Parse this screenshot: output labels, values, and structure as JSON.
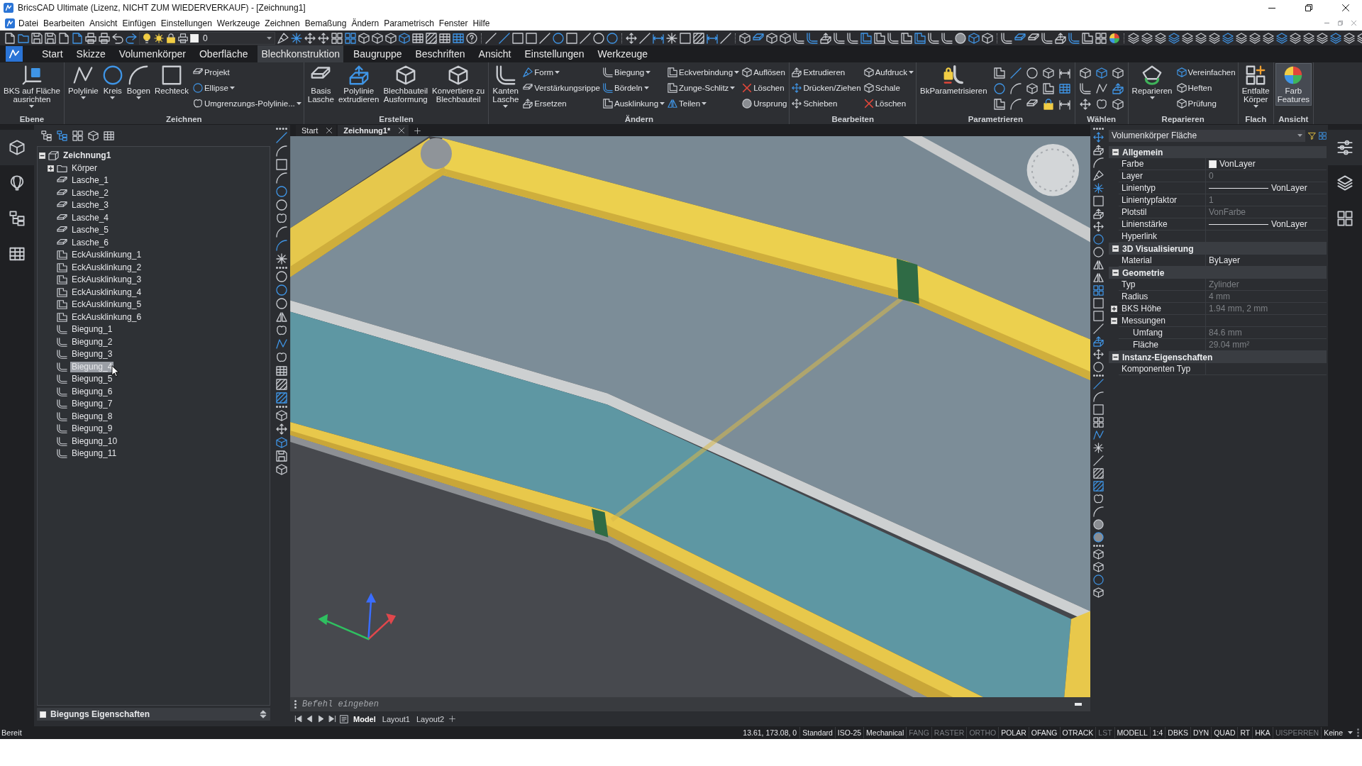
{
  "window": {
    "title": "BricsCAD Ultimate (Lizenz, NICHT ZUM WIEDERVERKAUF) - [Zeichnung1]"
  },
  "menu": [
    "Datei",
    "Bearbeiten",
    "Ansicht",
    "Einfügen",
    "Einstellungen",
    "Werkzeuge",
    "Zeichnen",
    "Bemaßung",
    "Ändern",
    "Parametrisch",
    "Fenster",
    "Hilfe"
  ],
  "quick_access": {
    "layer": "0"
  },
  "ribbon": {
    "tabs": [
      {
        "label": "Start",
        "selected": false
      },
      {
        "label": "Skizze",
        "selected": false
      },
      {
        "label": "Volumenkörper",
        "selected": false
      },
      {
        "label": "Oberfläche",
        "selected": false
      },
      {
        "label": "Blechkonstruktion",
        "selected": true
      },
      {
        "label": "Baugruppe",
        "selected": false
      },
      {
        "label": "Beschriften",
        "selected": false
      },
      {
        "label": "Ansicht",
        "selected": false
      },
      {
        "label": "Einstellungen",
        "selected": false
      },
      {
        "label": "Werkzeuge",
        "selected": false
      }
    ],
    "panels": [
      {
        "title": "Ebene",
        "groups": [
          {
            "kind": "large",
            "buttons": [
              {
                "label": "BKS auf Fläche\nausrichten",
                "dropdown": true
              }
            ]
          }
        ]
      },
      {
        "title": "Zeichnen",
        "groups": [
          {
            "kind": "large",
            "buttons": [
              {
                "label": "Polylinie",
                "dropdown": true
              },
              {
                "label": "Kreis",
                "dropdown": true
              },
              {
                "label": "Bogen",
                "dropdown": true
              },
              {
                "label": "Rechteck",
                "dropdown": false
              }
            ]
          },
          {
            "kind": "small",
            "buttons": [
              {
                "label": "Projekt",
                "dropdown": false
              },
              {
                "label": "Ellipse",
                "dropdown": true
              },
              {
                "label": "Umgrenzungs-Polylinie...",
                "dropdown": true
              }
            ]
          }
        ]
      },
      {
        "title": "Erstellen",
        "groups": [
          {
            "kind": "large",
            "buttons": [
              {
                "label": "Basis\nLasche",
                "dropdown": false
              },
              {
                "label": "Polylinie\nextrudieren",
                "dropdown": false
              },
              {
                "label": "Blechbauteil\nAusformung",
                "dropdown": false
              },
              {
                "label": "Konvertiere zu\nBlechbauteil",
                "dropdown": false
              }
            ]
          }
        ]
      },
      {
        "title": "Ändern",
        "groups": [
          {
            "kind": "large",
            "buttons": [
              {
                "label": "Kanten\nLasche",
                "dropdown": true
              }
            ]
          },
          {
            "kind": "small",
            "buttons": [
              {
                "label": "Form",
                "dropdown": true
              },
              {
                "label": "Verstärkungsrippe",
                "dropdown": false
              },
              {
                "label": "Ersetzen",
                "dropdown": false
              }
            ]
          },
          {
            "kind": "small",
            "buttons": [
              {
                "label": "Biegung",
                "dropdown": true
              },
              {
                "label": "Bördeln",
                "dropdown": true
              },
              {
                "label": "Ausklinkung",
                "dropdown": true
              }
            ]
          },
          {
            "kind": "small",
            "buttons": [
              {
                "label": "Eckverbindung",
                "dropdown": true
              },
              {
                "label": "Zunge-Schlitz",
                "dropdown": true
              },
              {
                "label": "Teilen",
                "dropdown": true
              }
            ]
          },
          {
            "kind": "small",
            "buttons": [
              {
                "label": "Auflösen",
                "dropdown": false
              },
              {
                "label": "Löschen",
                "dropdown": false
              },
              {
                "label": "Ursprung",
                "dropdown": false
              }
            ]
          }
        ]
      },
      {
        "title": "Bearbeiten",
        "groups": [
          {
            "kind": "small",
            "buttons": [
              {
                "label": "Extrudieren",
                "dropdown": false
              },
              {
                "label": "Drücken/Ziehen",
                "dropdown": false
              },
              {
                "label": "Schieben",
                "dropdown": false
              }
            ]
          },
          {
            "kind": "small",
            "buttons": [
              {
                "label": "Aufdruck",
                "dropdown": true
              },
              {
                "label": "Schale",
                "dropdown": false
              },
              {
                "label": "Löschen",
                "dropdown": false
              }
            ]
          }
        ]
      },
      {
        "title": "Parametrieren",
        "groups": [
          {
            "kind": "large",
            "buttons": [
              {
                "label": "BkParametrisieren",
                "dropdown": false
              }
            ]
          },
          {
            "kind": "icons"
          }
        ]
      },
      {
        "title": "Wählen",
        "groups": [
          {
            "kind": "icons"
          }
        ]
      },
      {
        "title": "Reparieren",
        "groups": [
          {
            "kind": "large",
            "buttons": [
              {
                "label": "Reparieren",
                "dropdown": true
              }
            ]
          },
          {
            "kind": "small",
            "buttons": [
              {
                "label": "Vereinfachen",
                "dropdown": false
              },
              {
                "label": "Heften",
                "dropdown": false
              },
              {
                "label": "Prüfung",
                "dropdown": false
              }
            ]
          }
        ]
      },
      {
        "title": "Flach",
        "groups": [
          {
            "kind": "large",
            "buttons": [
              {
                "label": "Entfalte\nKörper",
                "dropdown": true
              }
            ]
          }
        ]
      },
      {
        "title": "Ansicht",
        "groups": [
          {
            "kind": "large",
            "buttons": [
              {
                "label": "Farb\nFeatures",
                "dropdown": false,
                "active": true
              }
            ]
          }
        ]
      }
    ]
  },
  "left_dock": [
    {
      "selected": true
    },
    {
      "selected": false
    },
    {
      "selected": false
    },
    {
      "selected": false
    }
  ],
  "browser": {
    "tree": [
      {
        "label": "Zeichnung1",
        "kind": "drawing",
        "expanded": true,
        "selected": false,
        "children": [
          {
            "label": "Körper",
            "kind": "folder",
            "expanded": false,
            "selected": false
          },
          {
            "label": "Lasche_1",
            "kind": "flange",
            "selected": false
          },
          {
            "label": "Lasche_2",
            "kind": "flange",
            "selected": false
          },
          {
            "label": "Lasche_3",
            "kind": "flange",
            "selected": false
          },
          {
            "label": "Lasche_4",
            "kind": "flange",
            "selected": false
          },
          {
            "label": "Lasche_5",
            "kind": "flange",
            "selected": false
          },
          {
            "label": "Lasche_6",
            "kind": "flange",
            "selected": false
          },
          {
            "label": "EckAusklinkung_1",
            "kind": "corner-relief",
            "selected": false
          },
          {
            "label": "EckAusklinkung_2",
            "kind": "corner-relief",
            "selected": false
          },
          {
            "label": "EckAusklinkung_3",
            "kind": "corner-relief",
            "selected": false
          },
          {
            "label": "EckAusklinkung_4",
            "kind": "corner-relief",
            "selected": false
          },
          {
            "label": "EckAusklinkung_5",
            "kind": "corner-relief",
            "selected": false
          },
          {
            "label": "EckAusklinkung_6",
            "kind": "corner-relief",
            "selected": false
          },
          {
            "label": "Biegung_1",
            "kind": "bend",
            "selected": false
          },
          {
            "label": "Biegung_2",
            "kind": "bend",
            "selected": false
          },
          {
            "label": "Biegung_3",
            "kind": "bend",
            "selected": false
          },
          {
            "label": "Biegung_4",
            "kind": "bend",
            "selected": true
          },
          {
            "label": "Biegung_5",
            "kind": "bend",
            "selected": false
          },
          {
            "label": "Biegung_6",
            "kind": "bend",
            "selected": false
          },
          {
            "label": "Biegung_7",
            "kind": "bend",
            "selected": false
          },
          {
            "label": "Biegung_8",
            "kind": "bend",
            "selected": false
          },
          {
            "label": "Biegung_9",
            "kind": "bend",
            "selected": false
          },
          {
            "label": "Biegung_10",
            "kind": "bend",
            "selected": false
          },
          {
            "label": "Biegung_11",
            "kind": "bend",
            "selected": false
          }
        ]
      }
    ],
    "footer": "Biegungs Eigenschaften"
  },
  "document_tabs": [
    {
      "label": "Start",
      "selected": false
    },
    {
      "label": "Zeichnung1*",
      "selected": true
    }
  ],
  "command_line": {
    "placeholder": "Befehl eingeben"
  },
  "layout_tabs": [
    {
      "label": "Model",
      "selected": true
    },
    {
      "label": "Layout1",
      "selected": false
    },
    {
      "label": "Layout2",
      "selected": false
    }
  ],
  "properties": {
    "selector": "Volumenkörper Fläche",
    "sections": [
      {
        "title": "Allgemein",
        "expanded": true,
        "rows": [
          {
            "label": "Farbe",
            "value": "VonLayer",
            "kind": "color",
            "disabled": false
          },
          {
            "label": "Layer",
            "value": "0",
            "kind": "text",
            "disabled": true
          },
          {
            "label": "Linientyp",
            "value": "VonLayer",
            "kind": "linetype",
            "disabled": false
          },
          {
            "label": "Linientypfaktor",
            "value": "1",
            "kind": "text",
            "disabled": true
          },
          {
            "label": "Plotstil",
            "value": "VonFarbe",
            "kind": "text",
            "disabled": true
          },
          {
            "label": "Linienstärke",
            "value": "VonLayer",
            "kind": "linetype",
            "disabled": false
          },
          {
            "label": "Hyperlink",
            "kind": "text"
          }
        ]
      },
      {
        "title": "3D Visualisierung",
        "expanded": true,
        "rows": [
          {
            "label": "Material",
            "value": "ByLayer",
            "kind": "text",
            "disabled": false
          }
        ]
      },
      {
        "title": "Geometrie",
        "expanded": true,
        "rows": [
          {
            "label": "Typ",
            "value": "Zylinder",
            "kind": "text",
            "disabled": true
          },
          {
            "label": "Radius",
            "value": "4 mm",
            "kind": "text",
            "disabled": true
          },
          {
            "label": "BKS Höhe",
            "value": "1.94 mm, 2 mm",
            "kind": "group",
            "expanded": false,
            "disabled": true
          },
          {
            "label": "Messungen",
            "kind": "group",
            "expanded": true,
            "children": [
              {
                "label": "Umfang",
                "value": "84.6 mm",
                "kind": "text",
                "disabled": true
              },
              {
                "label": "Fläche",
                "value": "29.04 mm²",
                "kind": "text",
                "disabled": true
              }
            ]
          }
        ]
      },
      {
        "title": "Instanz-Eigenschaften",
        "expanded": true,
        "rows": [
          {
            "label": "Komponenten Typ",
            "kind": "text"
          }
        ]
      }
    ]
  },
  "right_dock": [
    {
      "selected": true
    },
    {
      "selected": false
    },
    {
      "selected": false
    }
  ],
  "status_bar": {
    "message": "Bereit",
    "coordinates": "13.61, 173.08, 0",
    "items": [
      {
        "label": "Standard",
        "on": true
      },
      {
        "label": "ISO-25",
        "on": true
      },
      {
        "label": "Mechanical",
        "on": true
      },
      {
        "label": "FANG",
        "on": false
      },
      {
        "label": "RASTER",
        "on": false
      },
      {
        "label": "ORTHO",
        "on": false
      },
      {
        "label": "POLAR",
        "on": true
      },
      {
        "label": "OFANG",
        "on": true
      },
      {
        "label": "OTRACK",
        "on": true
      },
      {
        "label": "LST",
        "on": false
      },
      {
        "label": "MODELL",
        "on": true
      },
      {
        "label": "1:4",
        "on": true
      },
      {
        "label": "DBKS",
        "on": true
      },
      {
        "label": "DYN",
        "on": true
      },
      {
        "label": "QUAD",
        "on": true
      },
      {
        "label": "RT",
        "on": true
      },
      {
        "label": "HKA",
        "on": true
      },
      {
        "label": "UISPERREN",
        "on": false
      },
      {
        "label": "Keine",
        "on": true
      }
    ]
  }
}
